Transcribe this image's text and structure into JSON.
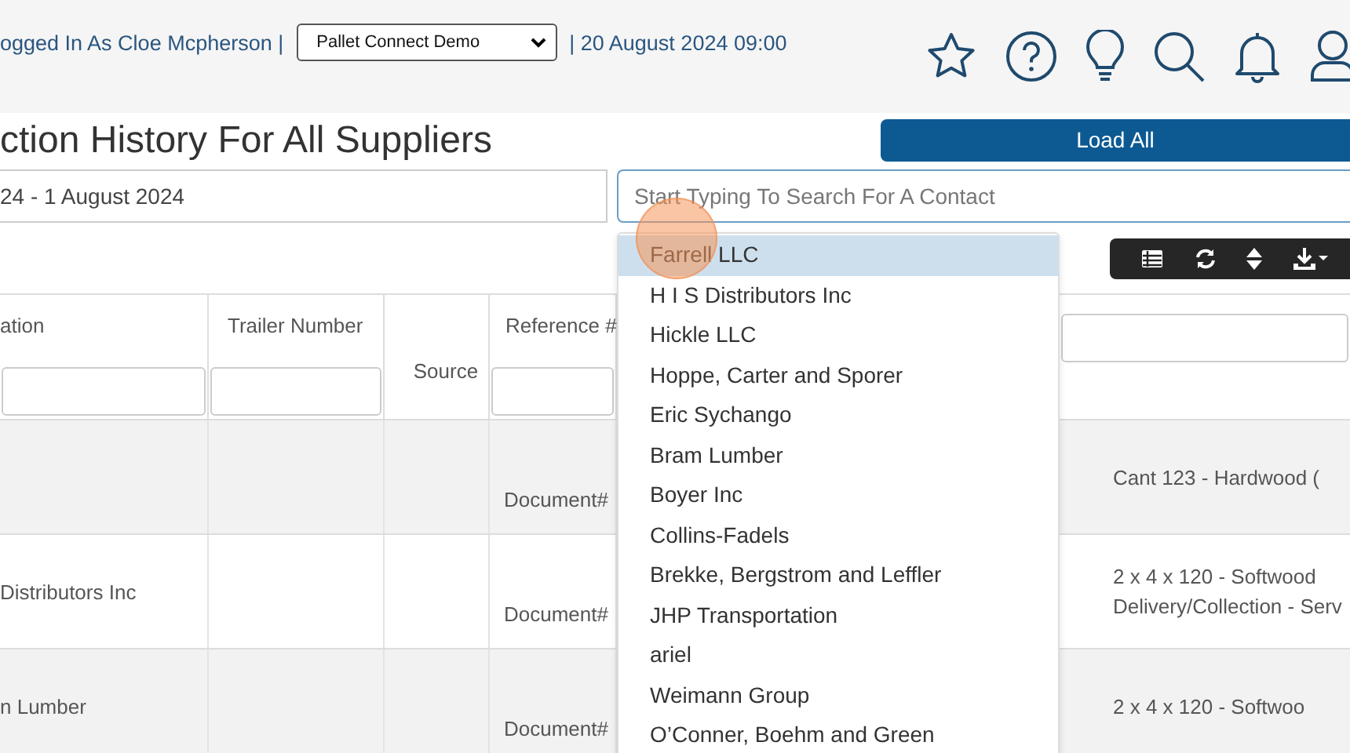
{
  "header": {
    "user_text": "ogged In As Cloe Mcpherson |",
    "company_select": "Pallet Connect Demo",
    "datetime": "| 20 August 2024 09:00"
  },
  "page_title": "ction History For All Suppliers",
  "load_all_button": "Load All",
  "date_range": "24 - 1 August 2024",
  "contact_search": {
    "placeholder": "Start Typing To Search For A Contact"
  },
  "suggestions": [
    {
      "label": "Farrell LLC",
      "selected": true
    },
    {
      "label": "H I S Distributors Inc",
      "selected": false
    },
    {
      "label": "Hickle LLC",
      "selected": false
    },
    {
      "label": "Hoppe, Carter and Sporer",
      "selected": false
    },
    {
      "label": "Eric Sychango",
      "selected": false
    },
    {
      "label": "Bram Lumber",
      "selected": false
    },
    {
      "label": "Boyer Inc",
      "selected": false
    },
    {
      "label": "Collins-Fadels",
      "selected": false
    },
    {
      "label": "Brekke, Bergstrom and Leffler",
      "selected": false
    },
    {
      "label": "JHP Transportation",
      "selected": false
    },
    {
      "label": "ariel",
      "selected": false
    },
    {
      "label": "Weimann Group",
      "selected": false
    },
    {
      "label": "O’Conner, Boehm and Green",
      "selected": false
    }
  ],
  "table": {
    "columns": [
      {
        "label": "ation",
        "filter": true
      },
      {
        "label": "Trailer Number",
        "filter": true
      },
      {
        "label": "Source",
        "filter": false
      },
      {
        "label": "Reference #",
        "filter": true
      },
      {
        "filter": true
      }
    ],
    "rows": [
      {
        "reference": "Document#",
        "column_5": [
          "Cant 123 - Hardwood ("
        ]
      },
      {
        "column_1": "Distributors Inc",
        "reference": "Document#",
        "column_5": [
          "2 x 4 x 120 - Softwood",
          "Delivery/Collection - Serv"
        ]
      },
      {
        "column_1": "n Lumber",
        "reference": "Document#",
        "column_5": [
          "2 x 4 x 120 - Softwoo"
        ]
      }
    ]
  }
}
